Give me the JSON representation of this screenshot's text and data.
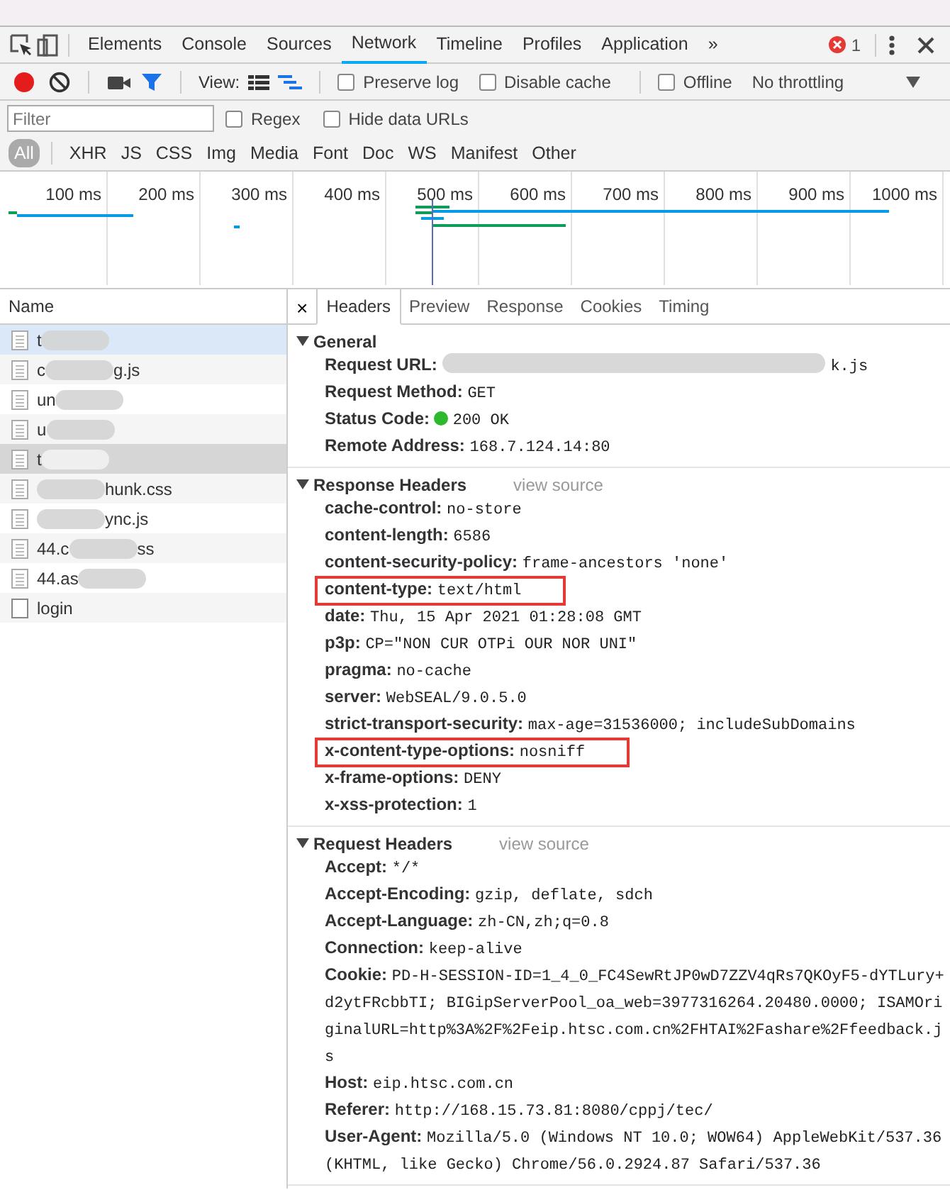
{
  "devtools_tabs": [
    {
      "label": "Elements",
      "selected": false
    },
    {
      "label": "Console",
      "selected": false
    },
    {
      "label": "Sources",
      "selected": false
    },
    {
      "label": "Network",
      "selected": true
    },
    {
      "label": "Timeline",
      "selected": false
    },
    {
      "label": "Profiles",
      "selected": false
    },
    {
      "label": "Application",
      "selected": false
    }
  ],
  "overflow": "»",
  "error_count": "1",
  "toolbar": {
    "recording": true,
    "view_label": "View:",
    "options": [
      {
        "label": "Preserve log",
        "checked": false
      },
      {
        "label": "Disable cache",
        "checked": false
      },
      {
        "label": "Offline",
        "checked": false
      }
    ],
    "throttling": "No throttling"
  },
  "filter": {
    "placeholder": "Filter",
    "options": [
      {
        "label": "Regex",
        "checked": false
      },
      {
        "label": "Hide data URLs",
        "checked": false
      }
    ]
  },
  "type_filters": [
    {
      "label": "All",
      "selected": true
    },
    {
      "label": "XHR",
      "selected": false
    },
    {
      "label": "JS",
      "selected": false
    },
    {
      "label": "CSS",
      "selected": false
    },
    {
      "label": "Img",
      "selected": false
    },
    {
      "label": "Media",
      "selected": false
    },
    {
      "label": "Font",
      "selected": false
    },
    {
      "label": "Doc",
      "selected": false
    },
    {
      "label": "WS",
      "selected": false
    },
    {
      "label": "Manifest",
      "selected": false
    },
    {
      "label": "Other",
      "selected": false
    }
  ],
  "timeline": {
    "ticks": [
      "100 ms",
      "200 ms",
      "300 ms",
      "400 ms",
      "500 ms",
      "600 ms",
      "700 ms",
      "800 ms",
      "900 ms",
      "1000 ms"
    ]
  },
  "requests": {
    "header": "Name",
    "items": [
      {
        "before": "t",
        "redacted": true,
        "selected": true,
        "hovered": false,
        "kind": "file"
      },
      {
        "before": "c",
        "after": "g.js",
        "redacted": true,
        "selected": false,
        "hovered": false,
        "kind": "file"
      },
      {
        "before": "un",
        "redacted": true,
        "selected": false,
        "hovered": false,
        "kind": "file"
      },
      {
        "before": "u",
        "redacted": true,
        "selected": false,
        "hovered": false,
        "kind": "file"
      },
      {
        "before": "t",
        "redacted": true,
        "selected": false,
        "hovered": true,
        "kind": "file"
      },
      {
        "after": "hunk.css",
        "redacted": true,
        "selected": false,
        "hovered": false,
        "kind": "file"
      },
      {
        "after": "ync.js",
        "redacted": true,
        "selected": false,
        "hovered": false,
        "kind": "file"
      },
      {
        "before": "44.c",
        "after": "ss",
        "redacted": true,
        "selected": false,
        "hovered": false,
        "kind": "file"
      },
      {
        "before": "44.as",
        "redacted": true,
        "selected": false,
        "hovered": false,
        "kind": "file"
      },
      {
        "before": "login",
        "redacted": false,
        "selected": false,
        "hovered": false,
        "kind": "blank"
      }
    ]
  },
  "detail": {
    "close": "×",
    "tabs": [
      {
        "label": "Headers",
        "selected": true
      },
      {
        "label": "Preview",
        "selected": false
      },
      {
        "label": "Response",
        "selected": false
      },
      {
        "label": "Cookies",
        "selected": false
      },
      {
        "label": "Timing",
        "selected": false
      }
    ],
    "sections": [
      {
        "title": "General",
        "expanded": true,
        "rows": [
          {
            "name": "Request URL:",
            "value": "k.js",
            "redacted": true,
            "kind": "text",
            "boxed": false
          },
          {
            "name": "Request Method:",
            "value": "GET",
            "kind": "text",
            "boxed": false
          },
          {
            "name": "Status Code:",
            "value": "200 OK",
            "kind": "status",
            "boxed": false
          },
          {
            "name": "Remote Address:",
            "value": "168.7.124.14:80",
            "kind": "text",
            "boxed": false
          }
        ]
      },
      {
        "title": "Response Headers",
        "expanded": true,
        "link": "view source",
        "rows": [
          {
            "name": "cache-control:",
            "value": "no-store",
            "kind": "text",
            "boxed": false
          },
          {
            "name": "content-length:",
            "value": "6586",
            "kind": "text",
            "boxed": false
          },
          {
            "name": "content-security-policy:",
            "value": "frame-ancestors 'none'",
            "kind": "text",
            "boxed": false
          },
          {
            "name": "content-type:",
            "value": "text/html",
            "kind": "text",
            "boxed": true
          },
          {
            "name": "date:",
            "value": "Thu, 15 Apr 2021 01:28:08 GMT",
            "kind": "text",
            "boxed": false
          },
          {
            "name": "p3p:",
            "value": "CP=\"NON CUR OTPi OUR NOR UNI\"",
            "kind": "text",
            "boxed": false
          },
          {
            "name": "pragma:",
            "value": "no-cache",
            "kind": "text",
            "boxed": false
          },
          {
            "name": "server:",
            "value": "WebSEAL/9.0.5.0",
            "kind": "text",
            "boxed": false
          },
          {
            "name": "strict-transport-security:",
            "value": "max-age=31536000; includeSubDomains",
            "kind": "text",
            "boxed": false
          },
          {
            "name": "x-content-type-options:",
            "value": "nosniff",
            "kind": "text",
            "boxed": true
          },
          {
            "name": "x-frame-options:",
            "value": "DENY",
            "kind": "text",
            "boxed": false
          },
          {
            "name": "x-xss-protection:",
            "value": "1",
            "kind": "text",
            "boxed": false
          }
        ]
      },
      {
        "title": "Request Headers",
        "expanded": true,
        "link": "view source",
        "rows": [
          {
            "name": "Accept:",
            "value": "*/*",
            "kind": "text",
            "boxed": false
          },
          {
            "name": "Accept-Encoding:",
            "value": "gzip, deflate, sdch",
            "kind": "text",
            "boxed": false
          },
          {
            "name": "Accept-Language:",
            "value": "zh-CN,zh;q=0.8",
            "kind": "text",
            "boxed": false
          },
          {
            "name": "Connection:",
            "value": "keep-alive",
            "kind": "text",
            "boxed": false
          },
          {
            "name": "Cookie:",
            "value": "PD-H-SESSION-ID=1_4_0_FC4SewRtJP0wD7ZZV4qRs7QKOyF5-dYTLury+d2ytFRcbbTI; BIGipServerPool_oa_web=3977316264.20480.0000; ISAMOriginalURL=http%3A%2F%2Feip.htsc.com.cn%2FHTAI%2Fashare%2Ffeedback.js",
            "kind": "text",
            "boxed": false
          },
          {
            "name": "Host:",
            "value": "eip.htsc.com.cn",
            "kind": "text",
            "boxed": false
          },
          {
            "name": "Referer:",
            "value": "http://168.15.73.81:8080/cppj/tec/",
            "kind": "text",
            "boxed": false
          },
          {
            "name": "User-Agent:",
            "value": "Mozilla/5.0 (Windows NT 10.0; WOW64) AppleWebKit/537.36 (KHTML, like Gecko) Chrome/56.0.2924.87 Safari/537.36",
            "kind": "text",
            "boxed": false
          }
        ]
      }
    ]
  }
}
